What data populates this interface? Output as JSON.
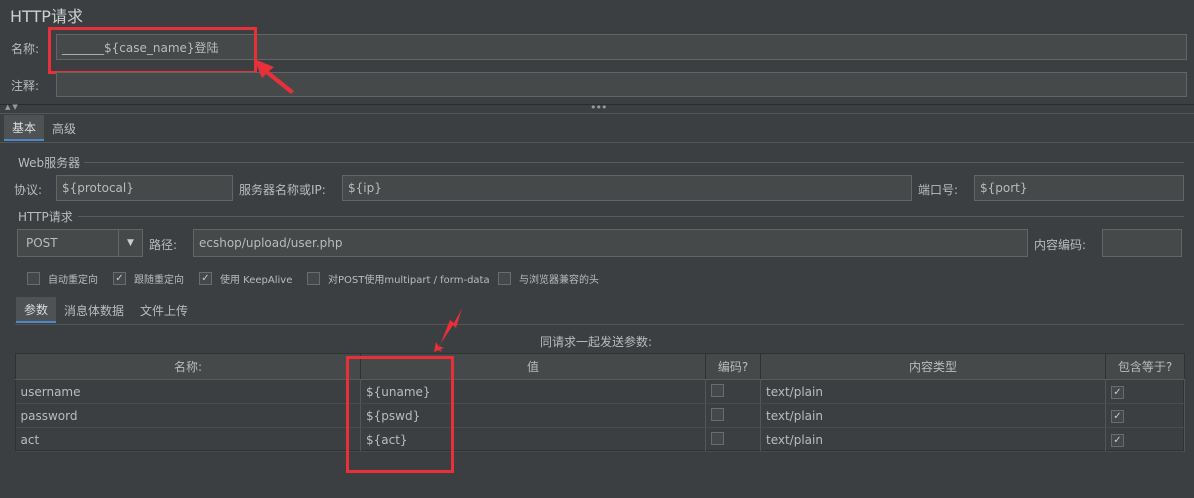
{
  "page": {
    "title": "HTTP请求",
    "name_label": "名称:",
    "name_value": "_______${case_name}登陆",
    "comment_label": "注释:",
    "comment_value": ""
  },
  "tabs": [
    {
      "label": "基本",
      "active": true
    },
    {
      "label": "高级",
      "active": false
    }
  ],
  "web_server": {
    "group_label": "Web服务器",
    "protocol_label": "协议:",
    "protocol_value": "${protocal}",
    "server_label": "服务器名称或IP:",
    "server_value": "${ip}",
    "port_label": "端口号:",
    "port_value": "${port}"
  },
  "http_request": {
    "group_label": "HTTP请求",
    "method": "POST",
    "path_label": "路径:",
    "path_value": "ecshop/upload/user.php",
    "encoding_label": "内容编码:",
    "encoding_value": "",
    "options": [
      {
        "label": "自动重定向",
        "checked": false
      },
      {
        "label": "跟随重定向",
        "checked": true
      },
      {
        "label": "使用 KeepAlive",
        "checked": true
      },
      {
        "label": "对POST使用multipart / form-data",
        "checked": false
      },
      {
        "label": "与浏览器兼容的头",
        "checked": false
      }
    ]
  },
  "sub_tabs": [
    {
      "label": "参数",
      "active": true
    },
    {
      "label": "消息体数据",
      "active": false
    },
    {
      "label": "文件上传",
      "active": false
    }
  ],
  "params": {
    "caption": "同请求一起发送参数:",
    "columns": [
      "名称:",
      "值",
      "编码?",
      "内容类型",
      "包含等于?"
    ],
    "rows": [
      {
        "name": "username",
        "value": "${uname}",
        "encode": false,
        "content_type": "text/plain",
        "include_equals": true
      },
      {
        "name": "password",
        "value": "${pswd}",
        "encode": false,
        "content_type": "text/plain",
        "include_equals": true
      },
      {
        "name": "act",
        "value": "${act}",
        "encode": false,
        "content_type": "text/plain",
        "include_equals": true
      }
    ]
  },
  "colors": {
    "background": "#3c3f41",
    "field": "#45494a",
    "annotation": "#e8303a"
  }
}
